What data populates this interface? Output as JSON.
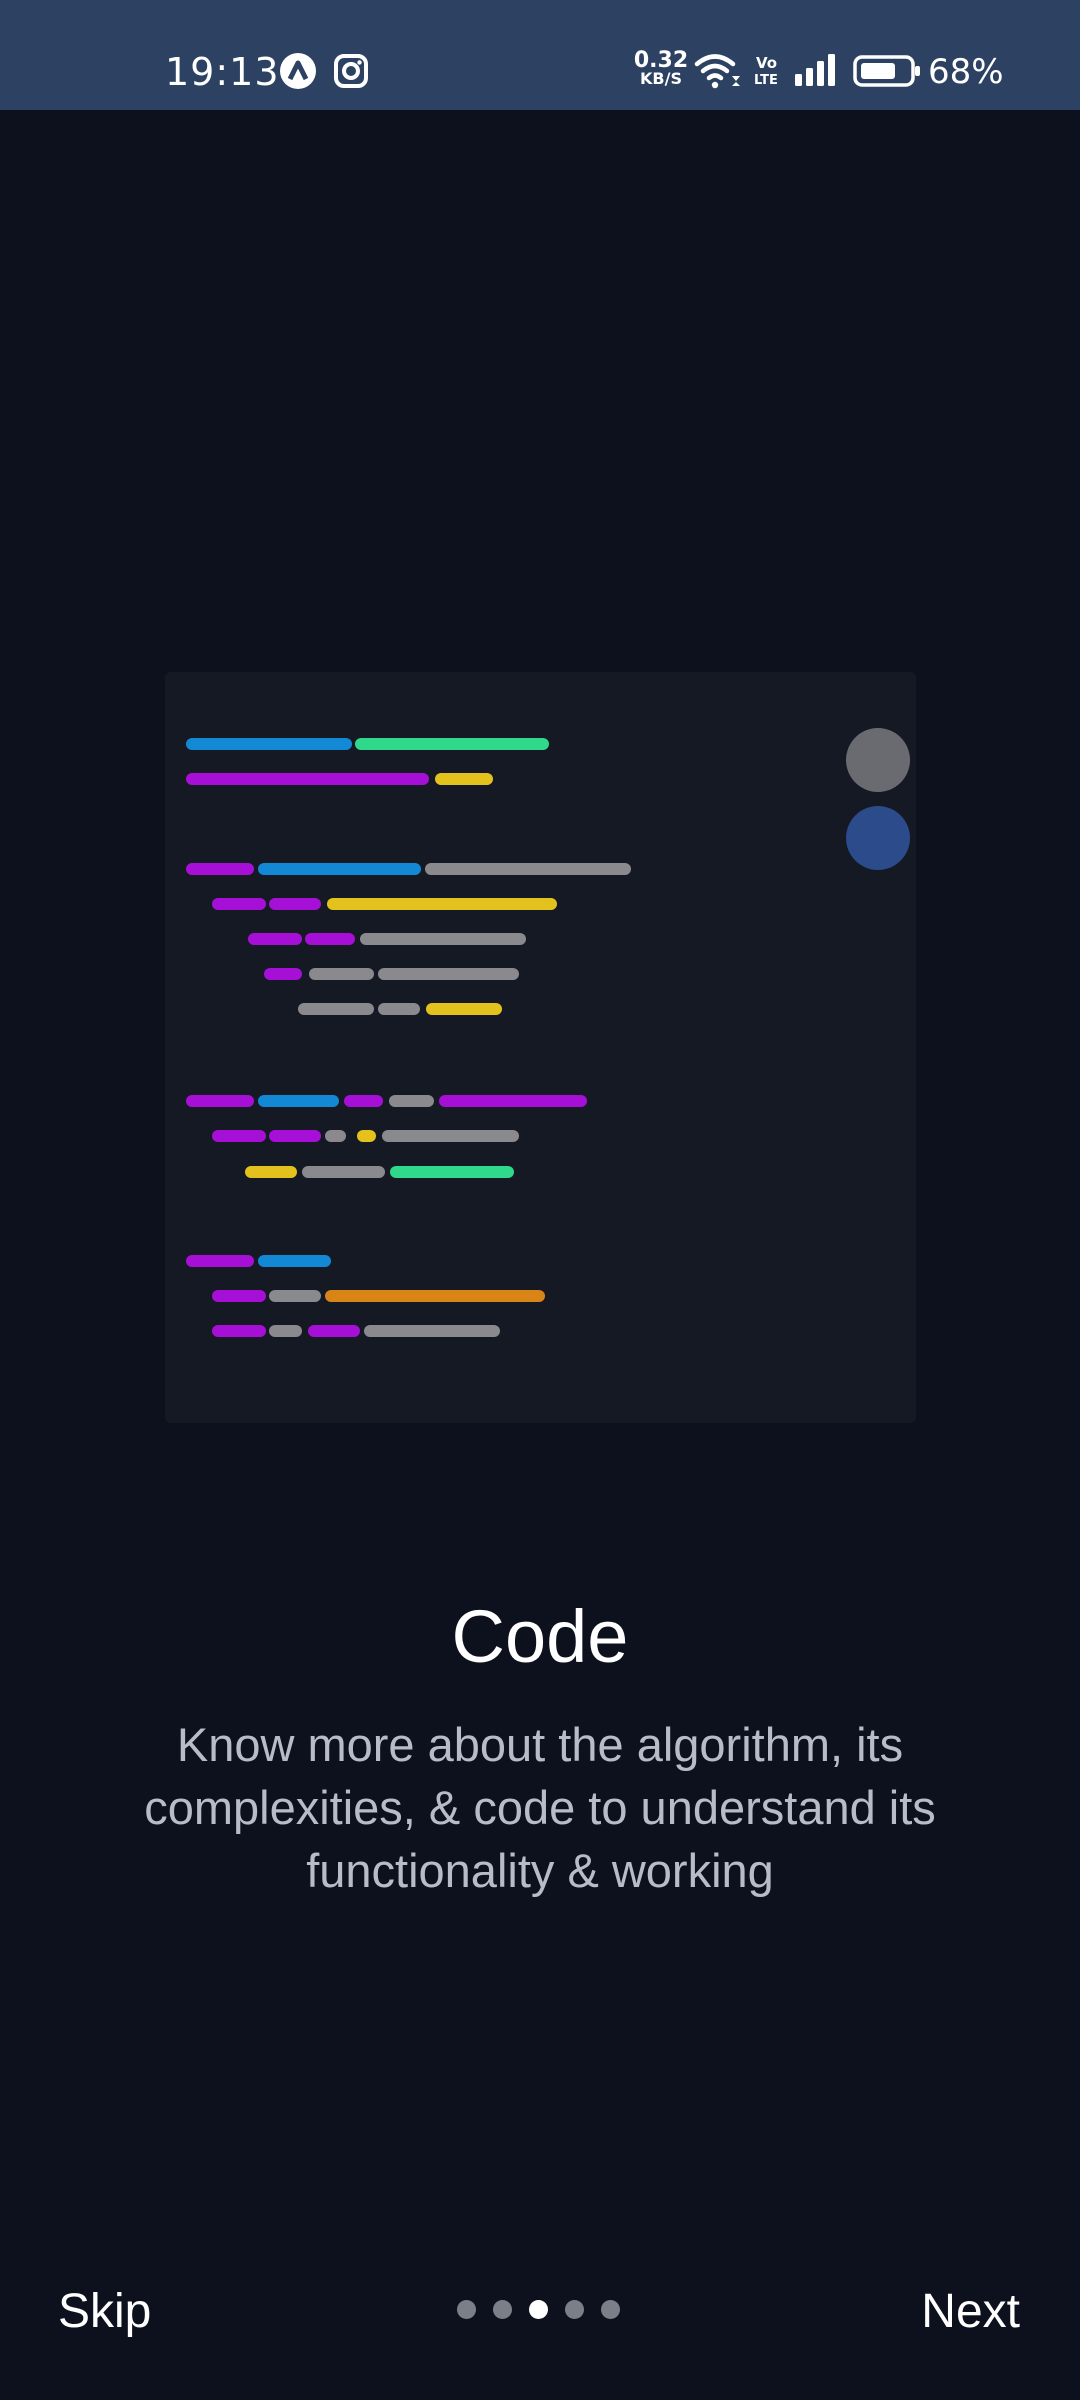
{
  "status_bar": {
    "time": "19:13",
    "network_speed_value": "0.32",
    "network_speed_unit": "KB/S",
    "battery_percent": "68%",
    "icons": [
      "app-a-icon",
      "instagram-icon",
      "wifi-icon",
      "volte-icon",
      "signal-icon",
      "battery-icon"
    ]
  },
  "slide": {
    "title": "Code",
    "description": "Know more about the algorithm, its complexities, & code to understand its functionality & working"
  },
  "nav": {
    "skip_label": "Skip",
    "next_label": "Next",
    "page_count": 5,
    "active_page": 3
  },
  "colors": {
    "background": "#0d111e",
    "status_bar": "#2d4262",
    "card": "#141924",
    "purple": "#a60fd6",
    "blue": "#1389d6",
    "green": "#2fd88a",
    "grey": "#8a8a8e",
    "yellow": "#e3c21d",
    "orange": "#d98417",
    "indicator_grey": "#6a6b70",
    "indicator_blue": "#2b4b8a"
  }
}
